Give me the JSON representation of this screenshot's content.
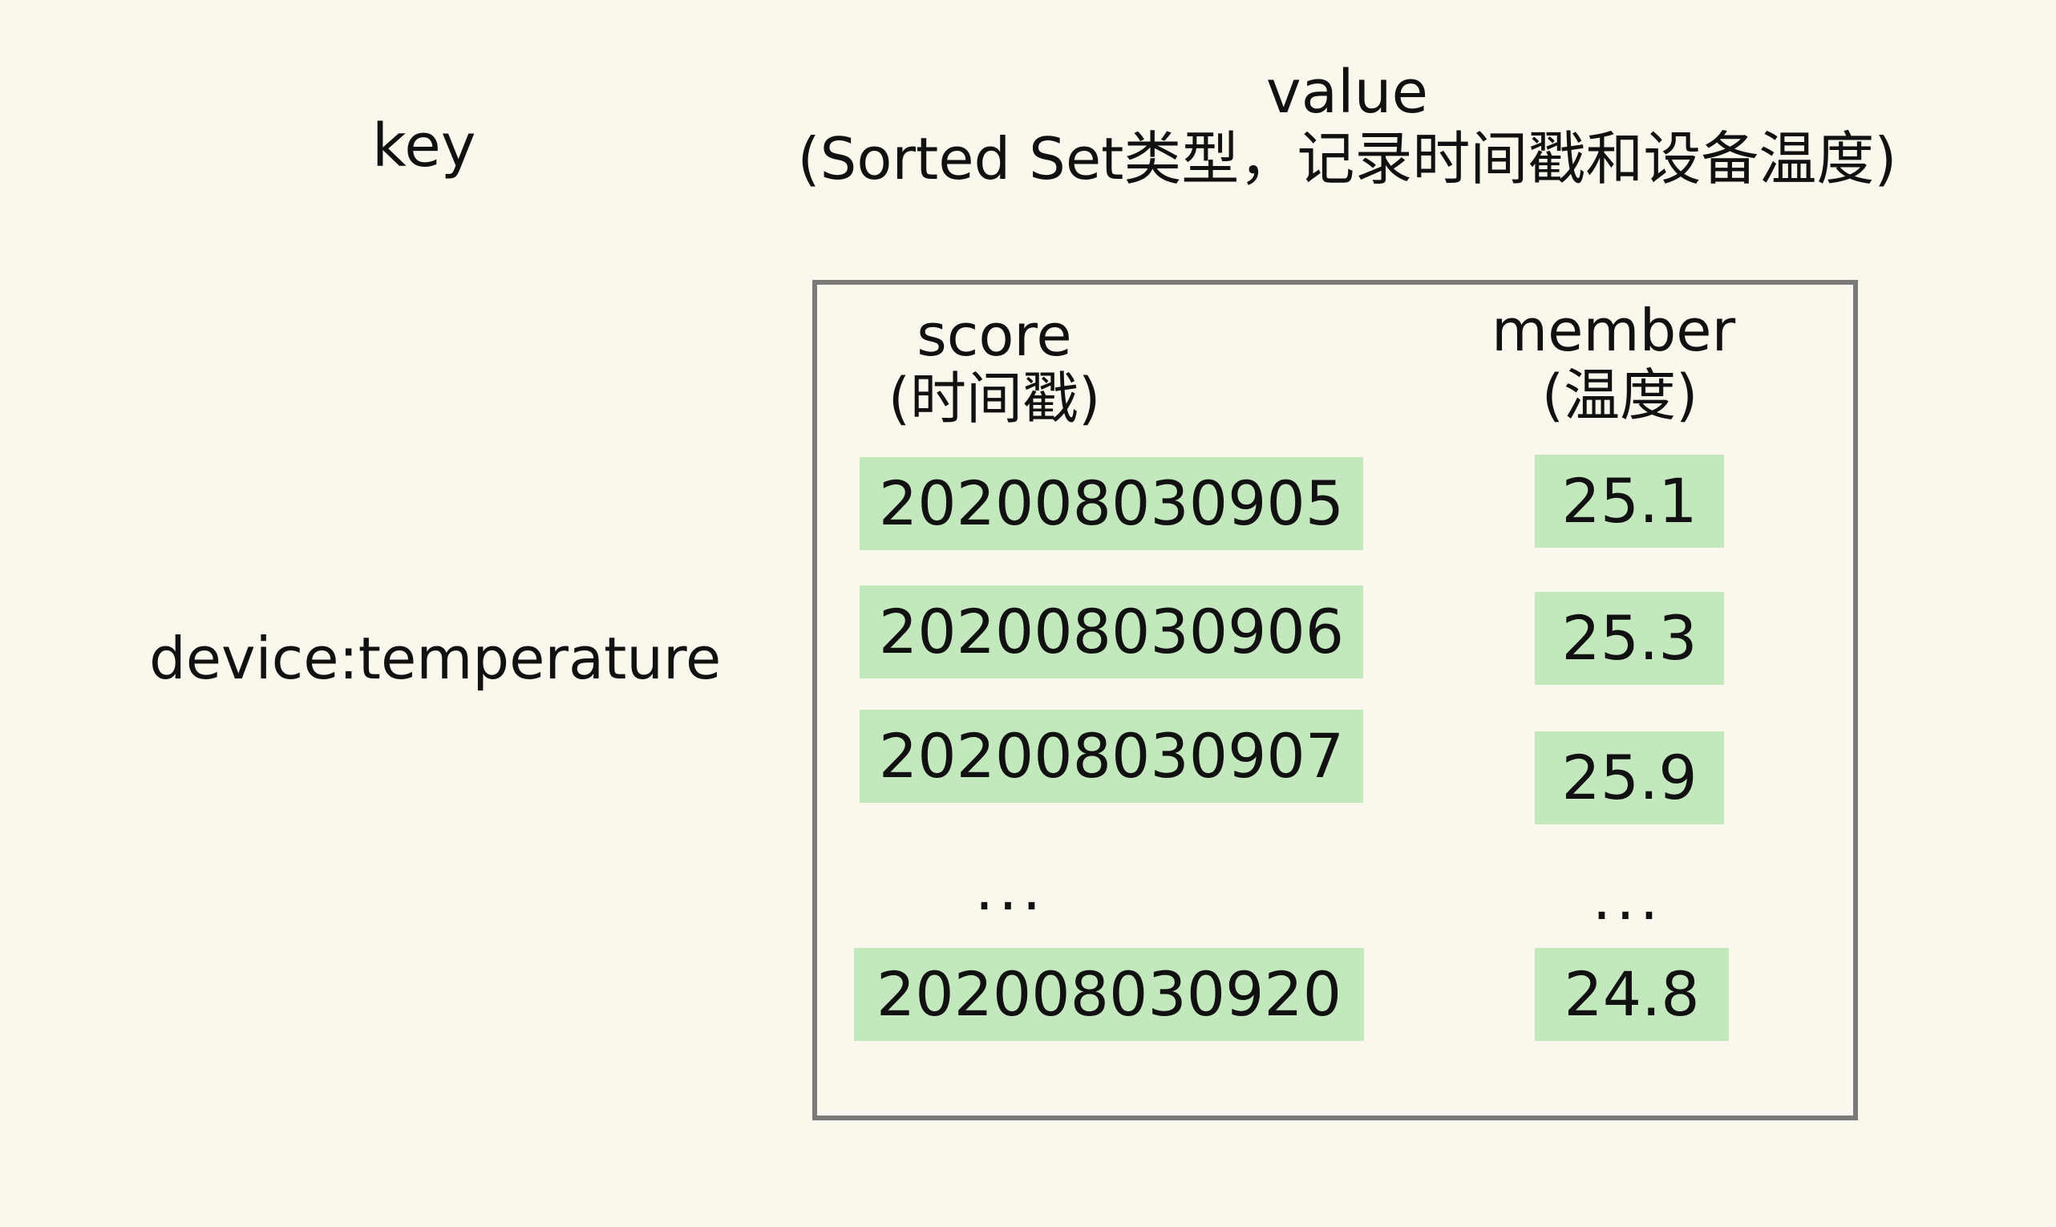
{
  "key": {
    "header": "key",
    "name": "device:temperature"
  },
  "value": {
    "header": "value",
    "subtitle": "(Sorted Set类型，记录时间戳和设备温度)"
  },
  "zset": {
    "score_header": "score",
    "score_sub": "(时间戳)",
    "member_header": "member",
    "member_sub": "(温度)",
    "rows": [
      {
        "score": "202008030905",
        "member": "25.1"
      },
      {
        "score": "202008030906",
        "member": "25.3"
      },
      {
        "score": "202008030907",
        "member": "25.9"
      },
      {
        "score": "202008030920",
        "member": "24.8"
      }
    ],
    "ellipsis": "..."
  },
  "colors": {
    "background": "#faf8ed",
    "cell_fill": "#c3e8bd",
    "box_border": "#7a7a7a"
  }
}
